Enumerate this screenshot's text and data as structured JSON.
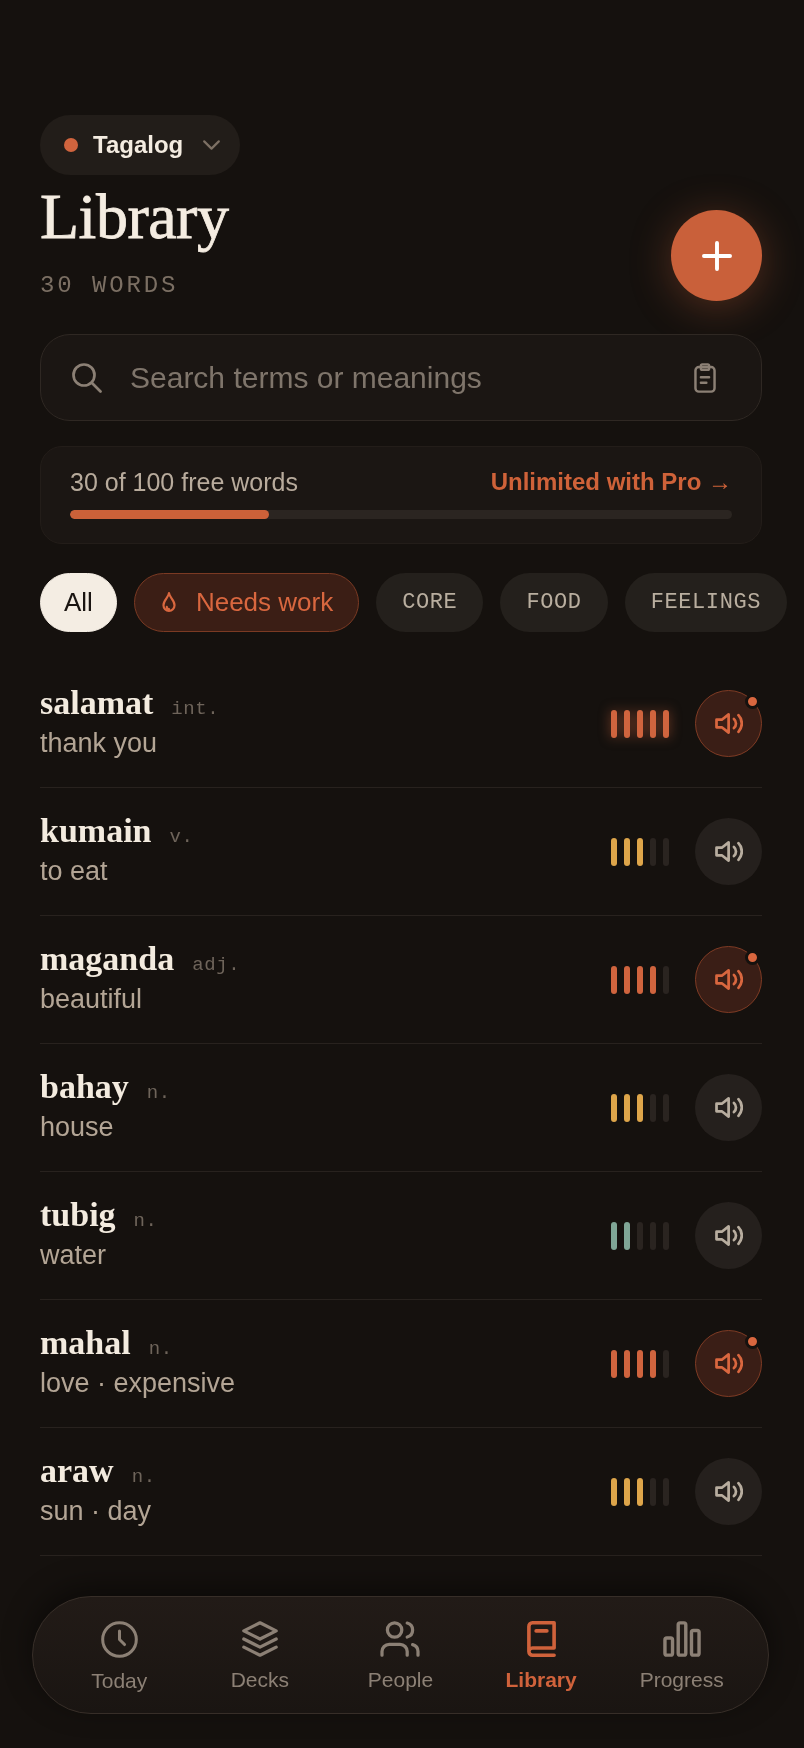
{
  "language_selector": {
    "label": "Tagalog"
  },
  "header": {
    "title": "Library",
    "count": "30 WORDS"
  },
  "search": {
    "placeholder": "Search terms or meanings"
  },
  "quota": {
    "label": "30 of 100 free words",
    "link": "Unlimited with Pro →",
    "level": 0.3
  },
  "filters": [
    {
      "label": "All",
      "kind": "plain",
      "selected": true
    },
    {
      "label": "Needs work",
      "kind": "flagged",
      "selected": false
    },
    {
      "label": "CORE",
      "kind": "tag",
      "selected": false
    },
    {
      "label": "FOOD",
      "kind": "tag",
      "selected": false
    },
    {
      "label": "FEELINGS",
      "kind": "tag",
      "selected": false
    }
  ],
  "words": [
    {
      "term": "salamat",
      "pos": "int.",
      "meaning": "thank you",
      "level": 1,
      "active": true
    },
    {
      "term": "kumain",
      "pos": "v.",
      "meaning": "to eat",
      "level": 0.6,
      "active": false
    },
    {
      "term": "maganda",
      "pos": "adj.",
      "meaning": "beautiful",
      "level": 0.8,
      "active": true
    },
    {
      "term": "bahay",
      "pos": "n.",
      "meaning": "house",
      "level": 0.6,
      "active": false
    },
    {
      "term": "tubig",
      "pos": "n.",
      "meaning": "water",
      "level": 0.4,
      "active": false
    },
    {
      "term": "mahal",
      "pos": "n.",
      "meaning": "love · expensive",
      "level": 0.8,
      "active": true
    },
    {
      "term": "araw",
      "pos": "n.",
      "meaning": "sun · day",
      "level": 0.6,
      "active": false
    }
  ],
  "tab_bar": [
    {
      "label": "Today",
      "selected": false
    },
    {
      "label": "Decks",
      "selected": false
    },
    {
      "label": "People",
      "selected": false
    },
    {
      "label": "Library",
      "selected": true
    },
    {
      "label": "Progress",
      "selected": false
    }
  ]
}
